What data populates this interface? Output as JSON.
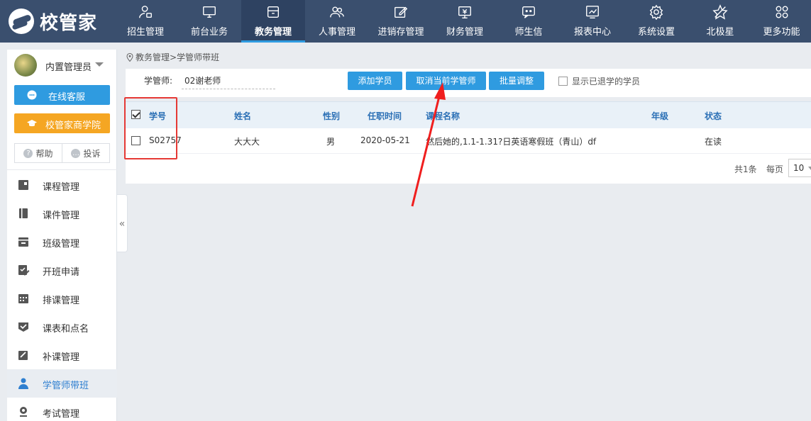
{
  "app": {
    "logo_text": "校管家"
  },
  "nav": {
    "items": [
      {
        "label": "招生管理",
        "icon": "enrollment-icon"
      },
      {
        "label": "前台业务",
        "icon": "monitor-icon"
      },
      {
        "label": "教务管理",
        "icon": "box-icon"
      },
      {
        "label": "人事管理",
        "icon": "users-icon"
      },
      {
        "label": "进销存管理",
        "icon": "edit-icon"
      },
      {
        "label": "财务管理",
        "icon": "finance-icon"
      },
      {
        "label": "师生信",
        "icon": "message-icon"
      },
      {
        "label": "报表中心",
        "icon": "report-icon"
      },
      {
        "label": "系统设置",
        "icon": "gear-icon"
      },
      {
        "label": "北极星",
        "icon": "star-icon"
      },
      {
        "label": "更多功能",
        "icon": "grid-icon"
      }
    ],
    "active_index": 2
  },
  "sidebar": {
    "user_name": "内置管理员",
    "service_label": "在线客服",
    "academy_label": "校管家商学院",
    "help_label": "帮助",
    "complaint_label": "投诉",
    "menu": [
      {
        "label": "课程管理",
        "icon": "course-icon"
      },
      {
        "label": "课件管理",
        "icon": "book-icon"
      },
      {
        "label": "班级管理",
        "icon": "class-icon"
      },
      {
        "label": "开班申请",
        "icon": "apply-icon"
      },
      {
        "label": "排课管理",
        "icon": "calendar-icon"
      },
      {
        "label": "课表和点名",
        "icon": "checklist-icon"
      },
      {
        "label": "补课管理",
        "icon": "makeup-icon"
      },
      {
        "label": "学管师带班",
        "icon": "teacher-icon"
      },
      {
        "label": "考试管理",
        "icon": "exam-icon"
      }
    ],
    "active_index": 7
  },
  "breadcrumb": "教务管理>学管师带班",
  "filter": {
    "teacher_label": "学管师:",
    "teacher_value": "02谢老师",
    "add_student": "添加学员",
    "cancel_current": "取消当前学管师",
    "batch_adjust": "批量调整",
    "show_withdrawn": "显示已退学的学员"
  },
  "table": {
    "headers": [
      "学号",
      "姓名",
      "性别",
      "任职时间",
      "课程名称",
      "年级",
      "状态"
    ],
    "rows": [
      {
        "id": "S02757",
        "name": "大大大",
        "gender": "男",
        "date": "2020-05-21",
        "course": "然后她的,1.1-1.31?日英语寒假班（青山）df",
        "grade": "",
        "status": "在读"
      }
    ]
  },
  "pager": {
    "total": "共1条",
    "per_page_label": "每页",
    "per_page_value": "10"
  }
}
